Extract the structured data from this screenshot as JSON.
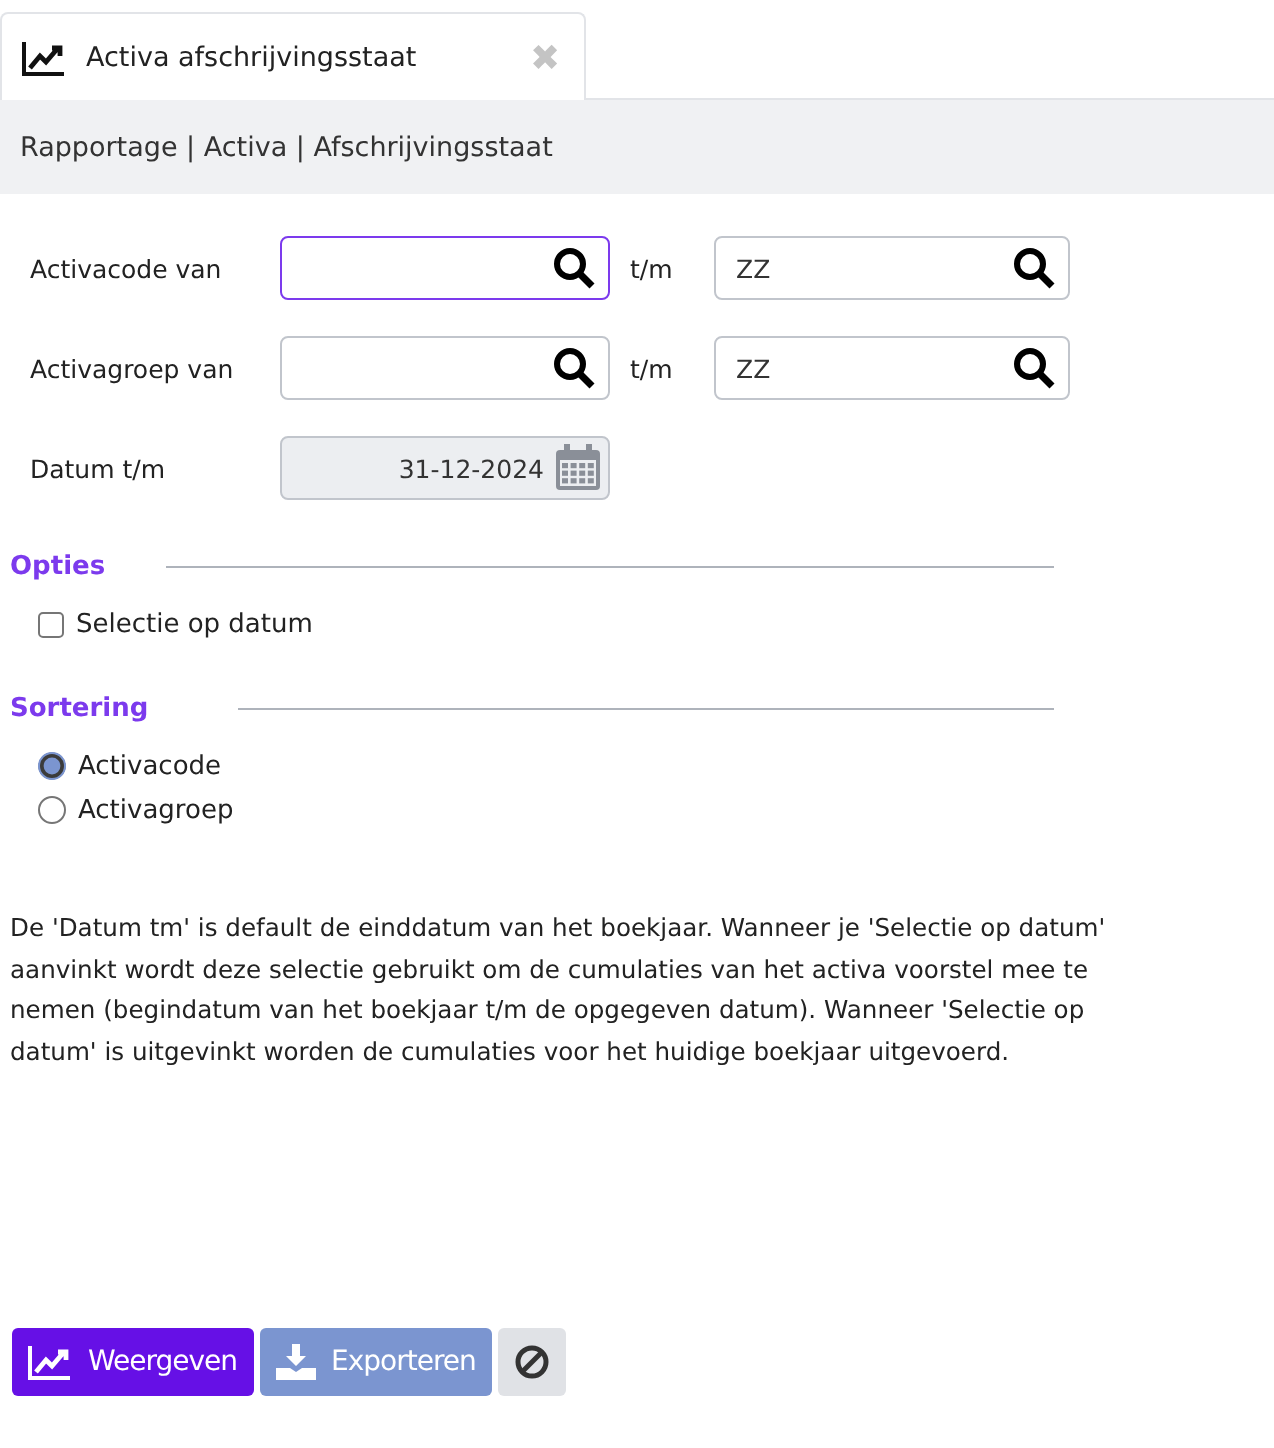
{
  "tab": {
    "title": "Activa afschrijvingsstaat",
    "close": "✖",
    "selected": true
  },
  "breadcrumb": "Rapportage | Activa | Afschrijvingsstaat",
  "ranges": [
    {
      "label": "Activacode van",
      "from": {
        "focused": true
      },
      "separator": "t/m",
      "to": {
        "value": "ZZ",
        "focused": false
      }
    },
    {
      "label": "Activagroep van",
      "from": {
        "focused": false
      },
      "separator": "t/m",
      "to": {
        "value": "ZZ",
        "focused": false
      }
    }
  ],
  "date": {
    "label": "Datum t/m",
    "value": "31-12-2024",
    "disabled": true
  },
  "options": {
    "title": "Opties",
    "items": [
      {
        "label": "Selectie op datum",
        "checked": false
      }
    ]
  },
  "sorting": {
    "title": "Sortering",
    "items": [
      {
        "label": "Activacode",
        "selected": true
      },
      {
        "label": "Activagroep",
        "selected": false
      }
    ]
  },
  "note": "De 'Datum tm' is default de einddatum van het boekjaar. Wanneer je 'Selectie op datum' aanvinkt wordt deze selectie gebruikt om de cumulaties van het activa voorstel mee te nemen (begindatum van het boekjaar t/m de opgegeven datum). Wanneer 'Selectie op datum' is uitgevinkt worden de cumulaties voor het huidige boekjaar uitgevoerd.",
  "buttons": [
    {
      "kind": "show",
      "label": "Weergeven"
    },
    {
      "kind": "export",
      "label": "Exporteren"
    },
    {
      "kind": "cancel"
    }
  ]
}
